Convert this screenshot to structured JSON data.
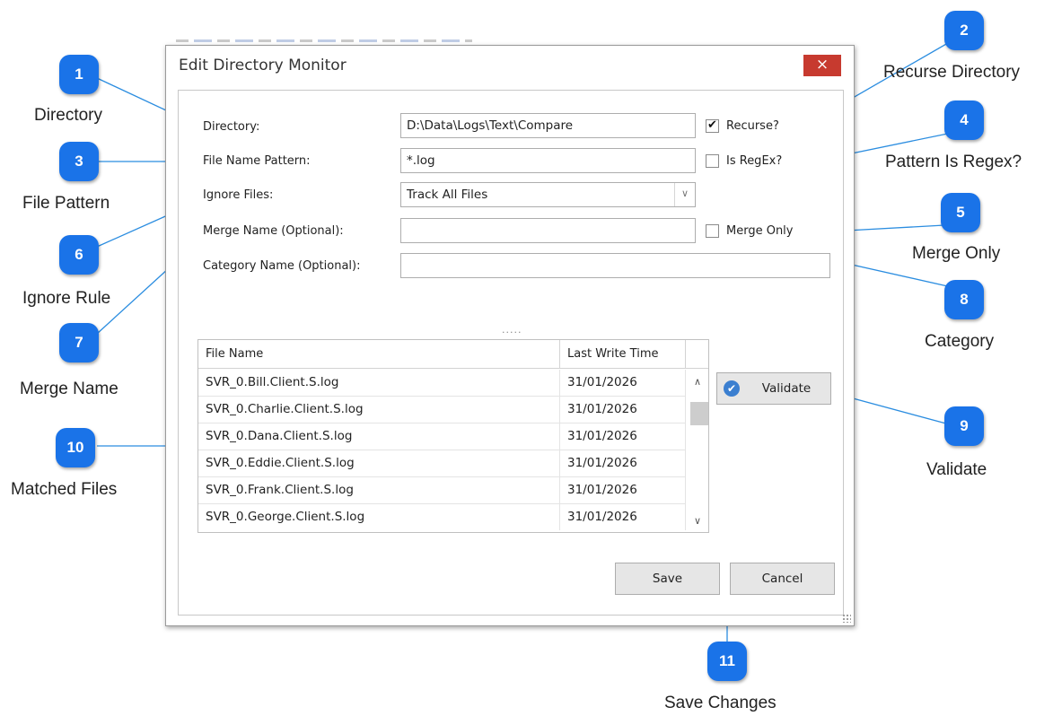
{
  "dialog": {
    "title": "Edit Directory Monitor",
    "close_label": "×",
    "fields": {
      "directory": {
        "label": "Directory:",
        "value": "D:\\Data\\Logs\\Text\\Compare"
      },
      "file_pattern": {
        "label": "File Name Pattern:",
        "value": "*.log"
      },
      "ignore_files": {
        "label": "Ignore Files:",
        "value": "Track All Files"
      },
      "merge_name": {
        "label": "Merge Name (Optional):",
        "value": ""
      },
      "category_name": {
        "label": "Category Name (Optional):",
        "value": ""
      }
    },
    "checkboxes": {
      "recurse": {
        "label": "Recurse?",
        "checked": true,
        "mark": "✔"
      },
      "is_regex": {
        "label": "Is RegEx?",
        "checked": false
      },
      "merge_only": {
        "label": "Merge Only",
        "checked": false
      }
    },
    "splitter": ".....",
    "grid": {
      "columns": [
        "File Name",
        "Last Write Time"
      ],
      "rows": [
        [
          "SVR_0.Bill.Client.S.log",
          "31/01/2026"
        ],
        [
          "SVR_0.Charlie.Client.S.log",
          "31/01/2026"
        ],
        [
          "SVR_0.Dana.Client.S.log",
          "31/01/2026"
        ],
        [
          "SVR_0.Eddie.Client.S.log",
          "31/01/2026"
        ],
        [
          "SVR_0.Frank.Client.S.log",
          "31/01/2026"
        ],
        [
          "SVR_0.George.Client.S.log",
          "31/01/2026"
        ]
      ]
    },
    "buttons": {
      "validate": "Validate",
      "save": "Save",
      "cancel": "Cancel"
    }
  },
  "callouts": [
    {
      "number": "1",
      "label": "Directory"
    },
    {
      "number": "2",
      "label": "Recurse Directory"
    },
    {
      "number": "3",
      "label": "File Pattern"
    },
    {
      "number": "4",
      "label": "Pattern Is Regex?"
    },
    {
      "number": "5",
      "label": "Merge Only"
    },
    {
      "number": "6",
      "label": "Ignore Rule"
    },
    {
      "number": "7",
      "label": "Merge Name"
    },
    {
      "number": "8",
      "label": "Category"
    },
    {
      "number": "9",
      "label": "Validate"
    },
    {
      "number": "10",
      "label": "Matched Files"
    },
    {
      "number": "11",
      "label": "Save Changes"
    }
  ],
  "colors": {
    "badge": "#1a73e8",
    "close": "#c73a2f",
    "connector": "#2b8de0"
  }
}
